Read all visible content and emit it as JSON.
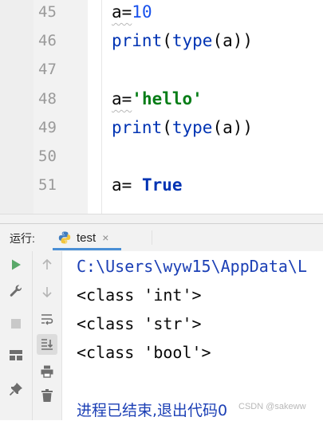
{
  "editor": {
    "lines": [
      {
        "num": "45",
        "parts": [
          "a=",
          "10"
        ]
      },
      {
        "num": "46",
        "parts": [
          "print",
          "(",
          "type",
          "(a))"
        ]
      },
      {
        "num": "47",
        "parts": []
      },
      {
        "num": "48",
        "parts": [
          "a=",
          "'hello'"
        ]
      },
      {
        "num": "49",
        "parts": [
          "print",
          "(",
          "type",
          "(a))"
        ]
      },
      {
        "num": "50",
        "parts": []
      },
      {
        "num": "51",
        "parts": [
          "a= ",
          "True"
        ]
      }
    ]
  },
  "run_panel": {
    "label": "运行:",
    "tab_name": "test",
    "tab_close": "×",
    "toolbar_icons": [
      "play-icon",
      "wrench-icon",
      "stop-icon",
      "layout-icon",
      "pin-icon",
      "up-arrow-icon",
      "down-arrow-icon",
      "soft-wrap-icon",
      "scroll-to-end-icon",
      "print-icon",
      "trash-icon"
    ]
  },
  "console": {
    "path_line": "C:\\Users\\wyw15\\AppData\\L",
    "output": [
      "<class 'int'>",
      "<class 'str'>",
      "<class 'bool'>"
    ],
    "exit_message": "进程已结束,退出代码0"
  },
  "watermark": "CSDN @sakeww"
}
